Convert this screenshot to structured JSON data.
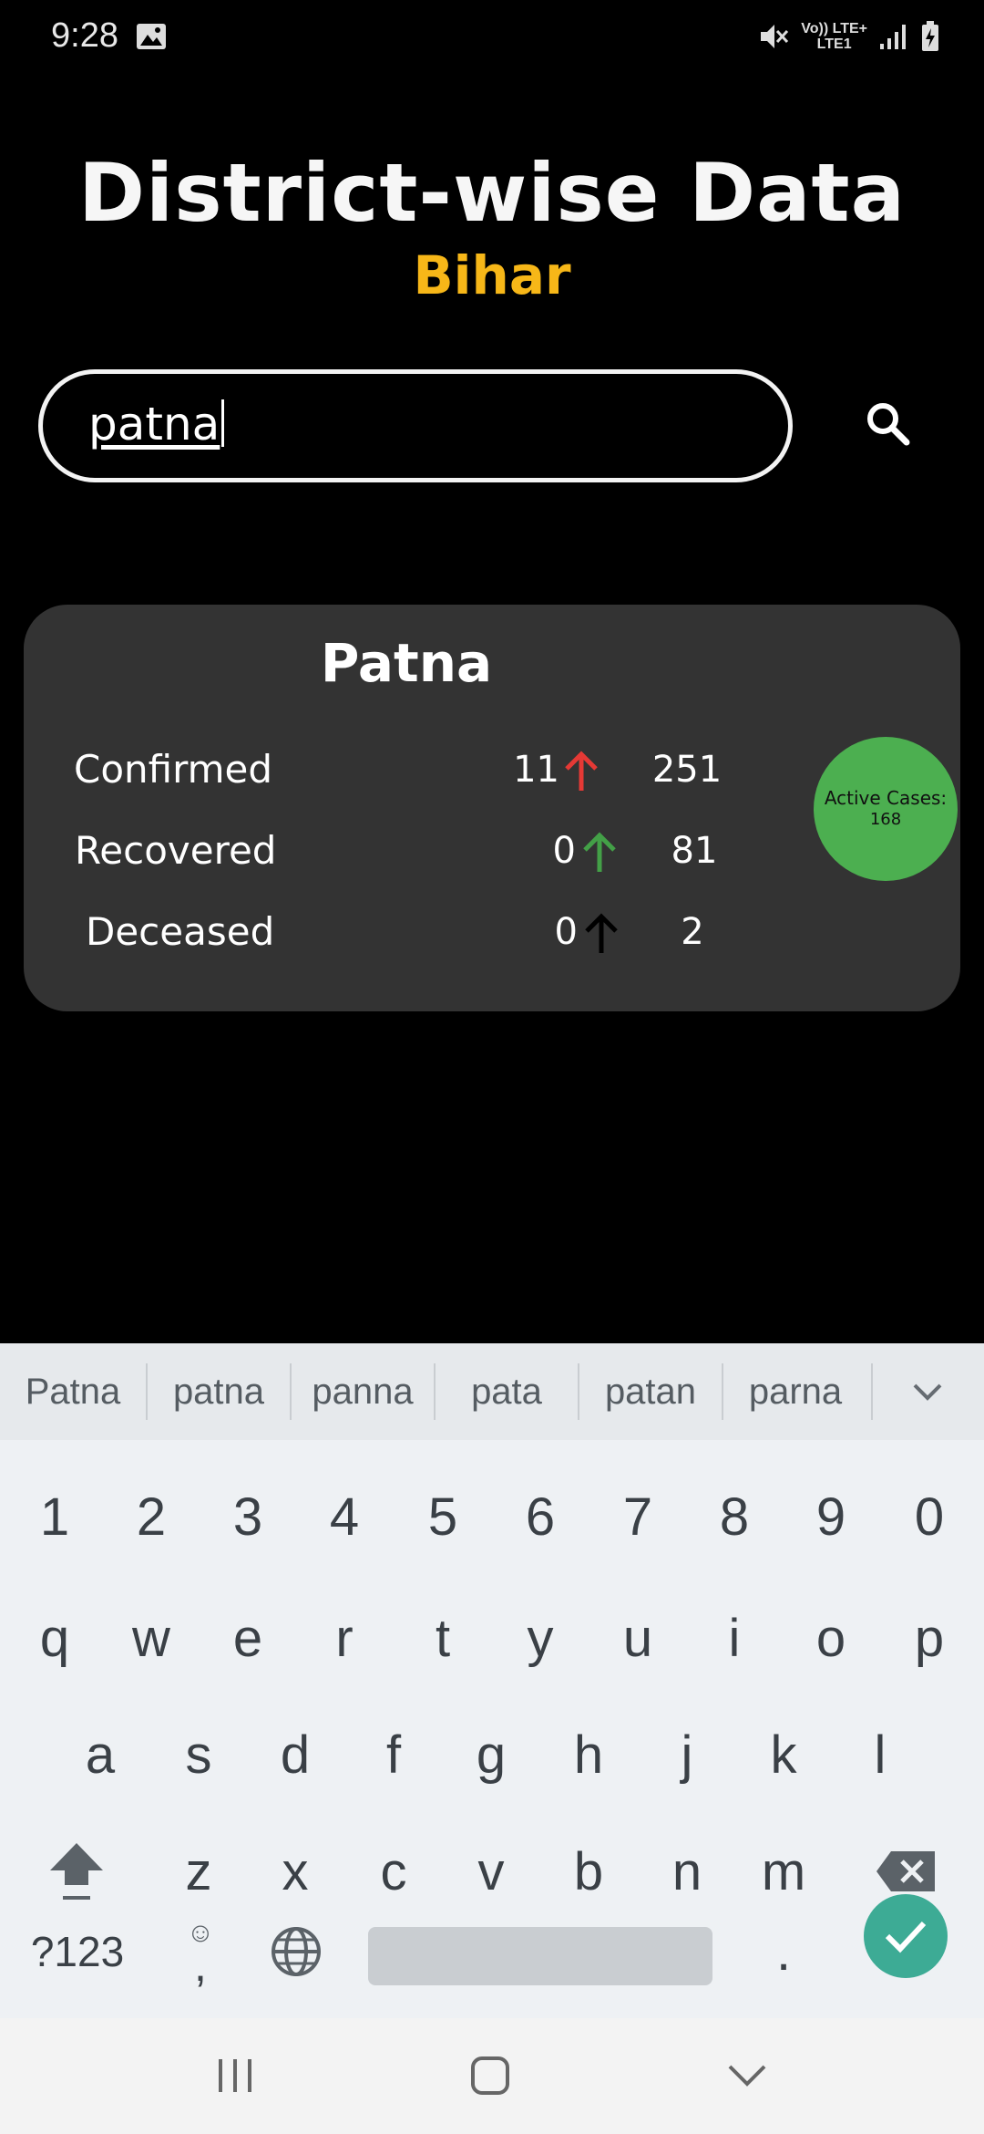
{
  "status_bar": {
    "time": "9:28",
    "network_top": "Vo)) LTE+",
    "network_bottom": "LTE1"
  },
  "header": {
    "title": "District-wise Data",
    "subtitle": "Bihar",
    "subtitle_color": "#f7b718"
  },
  "search": {
    "value": "patna",
    "icon": "search-icon"
  },
  "district_card": {
    "name": "Patna",
    "stats": [
      {
        "label": "Confirmed",
        "delta": "11",
        "arrow_color": "#e53935",
        "total": "251"
      },
      {
        "label": "Recovered",
        "delta": "0",
        "arrow_color": "#43a047",
        "total": "81"
      },
      {
        "label": "Deceased",
        "delta": "0",
        "arrow_color": "#000000",
        "total": "2"
      }
    ],
    "active_label": "Active Cases:",
    "active_value": "168",
    "active_color": "#4caf50"
  },
  "keyboard": {
    "suggestions": [
      "Patna",
      "patna",
      "panna",
      "pata",
      "patan",
      "parna"
    ],
    "number_row": [
      "1",
      "2",
      "3",
      "4",
      "5",
      "6",
      "7",
      "8",
      "9",
      "0"
    ],
    "row1": [
      "q",
      "w",
      "e",
      "r",
      "t",
      "y",
      "u",
      "i",
      "o",
      "p"
    ],
    "row2": [
      "a",
      "s",
      "d",
      "f",
      "g",
      "h",
      "j",
      "k",
      "l"
    ],
    "row3": [
      "z",
      "x",
      "c",
      "v",
      "b",
      "n",
      "m"
    ],
    "symbols_label": "?123",
    "comma_label": ",",
    "period_label": ".",
    "enter_color": "#3dab95"
  }
}
